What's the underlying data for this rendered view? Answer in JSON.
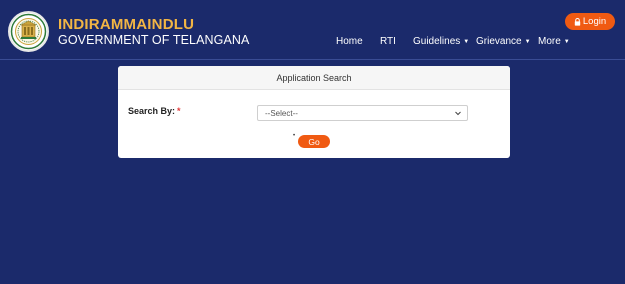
{
  "header": {
    "title": "INDIRAMMAINDLU",
    "subtitle": "GOVERNMENT OF TELANGANA",
    "logo_icon": "telangana-emblem-icon",
    "login_label": "Login",
    "login_icon": "lock-icon"
  },
  "nav": {
    "items": [
      {
        "label": "Home",
        "has_dropdown": false
      },
      {
        "label": "RTI",
        "has_dropdown": false
      },
      {
        "label": "Guidelines",
        "has_dropdown": true
      },
      {
        "label": "Grievance",
        "has_dropdown": true
      },
      {
        "label": "More",
        "has_dropdown": true
      }
    ]
  },
  "card": {
    "title": "Application Search",
    "search_by_label": "Search By:",
    "required_mark": "*",
    "select_value": "--Select--",
    "go_label": "Go",
    "go_marker": "•"
  },
  "colors": {
    "background": "#1b2a6b",
    "accent": "#f05a12",
    "title_gold": "#f2b544"
  }
}
